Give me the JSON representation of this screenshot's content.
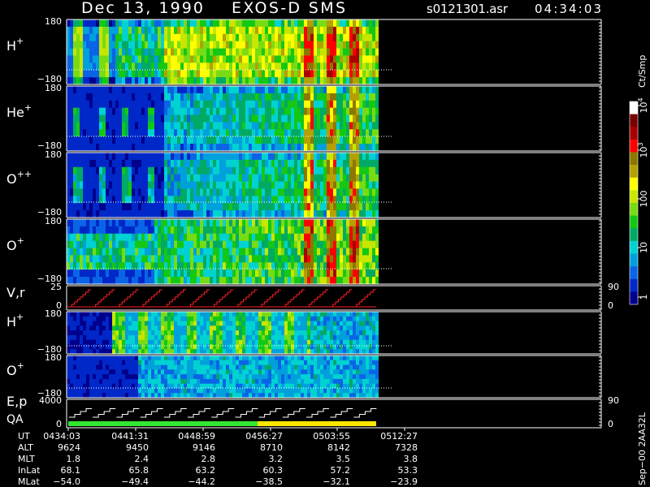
{
  "header": {
    "date": "Dec 13, 1990",
    "mission": "EXOS-D SMS",
    "file": "s0121301.asr",
    "time": "04:34:03"
  },
  "panels": [
    {
      "id": "hplus",
      "label": "H",
      "sup": "+",
      "ymax": "180",
      "ymin": "−180"
    },
    {
      "id": "heplus",
      "label": "He",
      "sup": "+",
      "ymax": "180",
      "ymin": "−180"
    },
    {
      "id": "oplusplus",
      "label": "O",
      "sup": "++",
      "ymax": "180",
      "ymin": "−180"
    },
    {
      "id": "oplus",
      "label": "O",
      "sup": "+",
      "ymax": "180",
      "ymin": "−180"
    },
    {
      "id": "vr",
      "label": "V,r",
      "sup": "",
      "ymax": "25",
      "ymin": "0",
      "right_top": "90",
      "right_bottom": "0"
    },
    {
      "id": "hplus2",
      "label": "H",
      "sup": "+",
      "ymax": "180",
      "ymin": "−180"
    },
    {
      "id": "oplus2",
      "label": "O",
      "sup": "+",
      "ymax": "180",
      "ymin": "−180"
    },
    {
      "id": "ep",
      "label": "E,p",
      "label2": "QA",
      "sup": "",
      "ymax": "4000",
      "ymin": "0",
      "right_top": "90",
      "right_bottom": "0"
    }
  ],
  "colorbar": {
    "title": "Ct/Smp",
    "ticks": [
      "1",
      "10",
      "100",
      "10",
      "10"
    ],
    "tick_sups": [
      "",
      "",
      "",
      "3",
      "4"
    ],
    "colors": [
      "#00008c",
      "#0028c8",
      "#0a64e6",
      "#00a0dc",
      "#00d2d2",
      "#00aa64",
      "#14c814",
      "#78dc14",
      "#c8e600",
      "#ffff00",
      "#b4a000",
      "#8c7800",
      "#ff0000",
      "#aa0000",
      "#780000",
      "#ffffff"
    ]
  },
  "footer": {
    "row_labels": [
      "UT",
      "ALT",
      "MLT",
      "InLat",
      "MLat"
    ],
    "columns": [
      [
        "0434:03",
        "9624",
        "1.8",
        "68.1",
        "−54.0"
      ],
      [
        "0441:31",
        "9450",
        "2.4",
        "65.8",
        "−49.4"
      ],
      [
        "0448:59",
        "9146",
        "2.8",
        "63.2",
        "−44.2"
      ],
      [
        "0456:27",
        "8710",
        "3.2",
        "60.3",
        "−38.5"
      ],
      [
        "0503:55",
        "8142",
        "3.5",
        "57.2",
        "−32.1"
      ],
      [
        "0512:27",
        "7328",
        "3.8",
        "53.3",
        "−23.9"
      ]
    ],
    "side_note": "Sep−00  2AA32L"
  },
  "chart_data": {
    "type": "heatmap",
    "title": "Dec 13, 1990   EXOS-D SMS",
    "x_ticks": [
      "0434:03",
      "0441:31",
      "0448:59",
      "0456:27",
      "0503:55",
      "0512:27"
    ],
    "panels": [
      "H+",
      "He+",
      "O++",
      "O+",
      "V,r",
      "H+",
      "O+",
      "E,p QA"
    ],
    "y_range_pitch": [
      -180,
      180
    ],
    "y_range_vr": [
      0,
      25
    ],
    "y_range_ep": [
      0,
      4000
    ],
    "colorbar_label": "Ct/Smp",
    "colorbar_ticks": [
      1,
      10,
      100,
      1000,
      10000
    ],
    "qa_status_segments": [
      {
        "color": "green",
        "from": "0434:03",
        "to": "0456:27"
      },
      {
        "color": "yellow",
        "from": "0456:27",
        "to": "0512:27"
      }
    ]
  }
}
